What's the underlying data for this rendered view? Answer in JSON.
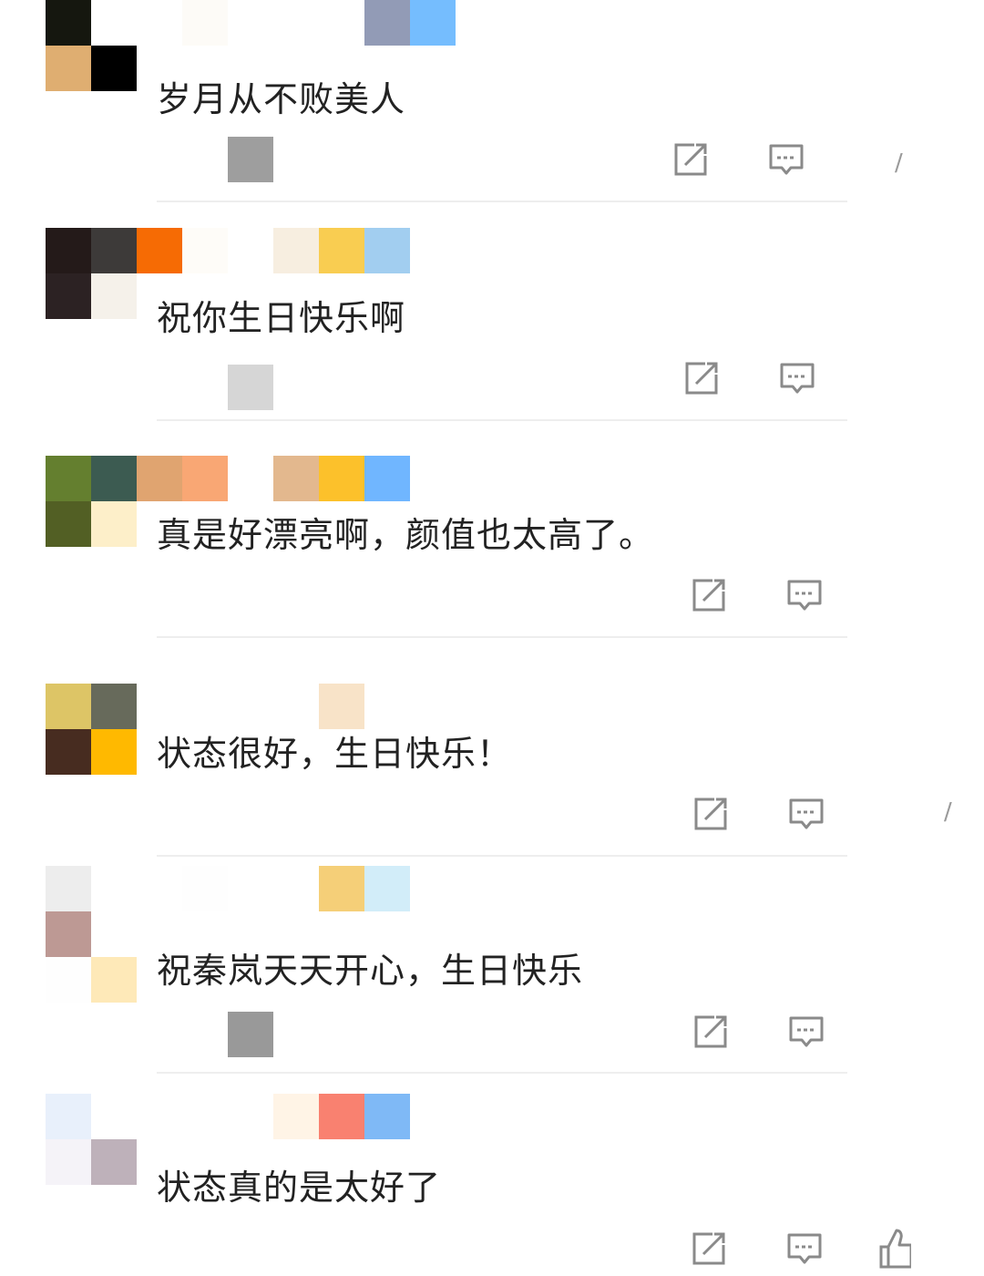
{
  "comments": [
    {
      "text": "岁月从不败美人",
      "avatar_colors": [
        "#15170f",
        "#ffffff",
        "#dfae71",
        "#000000"
      ],
      "name_colors": [
        "#ffffff",
        "#fdfbf7",
        "#ffffff",
        "#ffffff",
        "#ffffff",
        "#929bb6",
        "#75bdfe"
      ],
      "meta_color": "#9e9e9e"
    },
    {
      "text": "祝你生日快乐啊",
      "avatar_colors": [
        "#241a19",
        "#3d3a39",
        "#2c2223",
        "#f5f1ea"
      ],
      "name_colors": [
        "#f66b04",
        "#fefcf8",
        "#ffffff",
        "#f7eee0",
        "#f9cd51",
        "#a2cef0"
      ],
      "meta_color": "#d6d6d6"
    },
    {
      "text": "真是好漂亮啊，颜值也太高了。",
      "avatar_colors": [
        "#647f2f",
        "#3c5b51",
        "#525f24",
        "#fdefc9"
      ],
      "name_colors": [
        "#e0a470",
        "#f9a774",
        "#ffffff",
        "#e3b88e",
        "#fcc12b",
        "#70b6ff"
      ],
      "meta_color": "#ffffff"
    },
    {
      "text": "状态很好，生日快乐！",
      "avatar_colors": [
        "#ddc566",
        "#676a5b",
        "#472c20",
        "#ffb900"
      ],
      "name_colors": [
        "#ffffff",
        "#ffffff",
        "#ffffff",
        "#ffffff",
        "#f8e3c8",
        "#ffffff"
      ],
      "meta_color": "#ffffff"
    },
    {
      "text": "祝秦岚天天开心，生日快乐",
      "avatar_colors": [
        "#ededed",
        "#ffffff",
        "#bd9994",
        "#ffffff",
        "#fefefe",
        "#fee9b8"
      ],
      "name_colors": [
        "#ffffff",
        "#fefefe",
        "#ffffff",
        "#ffffff",
        "#f5cf78",
        "#d2edf9"
      ],
      "meta_color": "#999999"
    },
    {
      "text": "状态真的是太好了",
      "avatar_colors": [
        "#e8f0fb",
        "#ffffff",
        "#f5f3f8",
        "#beb1ba"
      ],
      "name_colors": [
        "#ffffff",
        "#ffffff",
        "#ffffff",
        "#fff4e6",
        "#f98170",
        "#7fb9f6"
      ],
      "meta_color": "#ffffff"
    }
  ],
  "icons": {
    "share": "share-icon",
    "reply": "reply-icon",
    "like": "like-icon"
  },
  "colors": {
    "icon": "#8a8a8a",
    "text": "#222222",
    "divider": "#eeeeee"
  }
}
